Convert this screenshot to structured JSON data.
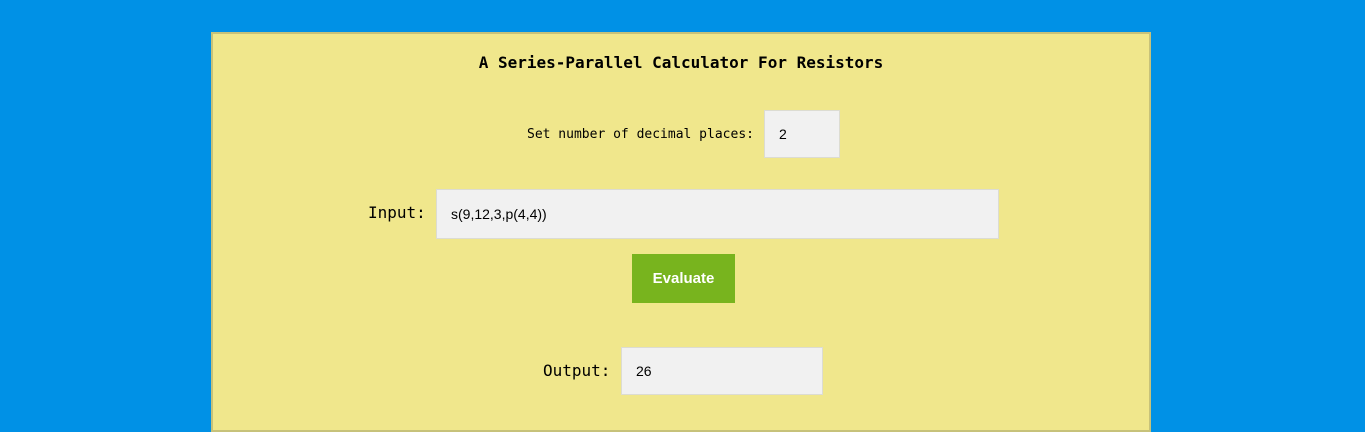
{
  "page": {
    "background_color": "#0091e6"
  },
  "panel": {
    "background_color": "#f0e78c",
    "title": "A Series-Parallel Calculator For Resistors"
  },
  "decimals": {
    "label": "Set number of decimal places:",
    "value": "2"
  },
  "input": {
    "label": "Input:",
    "value": "s(9,12,3,p(4,4))"
  },
  "evaluate_button": {
    "label": "Evaluate",
    "color": "#78b41e"
  },
  "output": {
    "label": "Output:",
    "value": "26"
  }
}
